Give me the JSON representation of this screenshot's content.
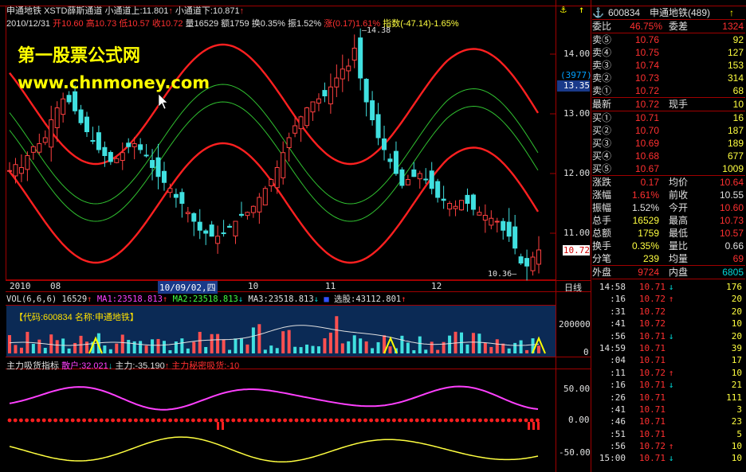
{
  "header": {
    "name": "申通地铁",
    "indicator": "XSTD薛斯通道",
    "upper_label": "小通道上:11.801",
    "lower_label": "小通道下:10.871",
    "date": "2010/12/31",
    "open": "开10.60",
    "high": "高10.73",
    "low": "低10.57",
    "close": "收10.72",
    "volume": "量16529",
    "amount": "额1759",
    "turnover": "换0.35%",
    "amplitude": "振1.52%",
    "change": "涨(0.17)1.61%",
    "index": "指数(-47.14)-1.65%"
  },
  "watermark": {
    "line1": "第一股票公式网",
    "line2": "www.chnmoney.com"
  },
  "price_chart": {
    "max_label": "14.38",
    "min_label": "10.36",
    "axis": [
      "14.00",
      "13.00",
      "12.00",
      "11.00"
    ],
    "cursor_count": "(3977)",
    "cursor_price": "13.35",
    "current_price": "10.72",
    "close_series": [
      12.05,
      12.15,
      12.1,
      12.3,
      12.45,
      12.5,
      12.6,
      12.9,
      13.1,
      13.25,
      13.2,
      13.05,
      12.85,
      12.7,
      12.55,
      12.4,
      12.3,
      12.2,
      12.25,
      12.35,
      12.45,
      12.5,
      12.4,
      12.3,
      12.1,
      11.95,
      11.85,
      11.75,
      11.6,
      11.5,
      11.35,
      11.2,
      11.05,
      11.0,
      10.95,
      10.95,
      11.0,
      11.1,
      11.2,
      11.3,
      11.35,
      11.45,
      11.6,
      11.75,
      11.9,
      12.1,
      12.35,
      12.6,
      12.8,
      12.95,
      13.1,
      13.2,
      13.25,
      13.3,
      13.45,
      13.6,
      13.75,
      13.8,
      14.1,
      13.6,
      13.2,
      12.9,
      12.6,
      12.4,
      12.2,
      12.0,
      11.8,
      11.9,
      11.95,
      12.0,
      11.9,
      11.75,
      11.6,
      11.55,
      11.5,
      11.45,
      11.55,
      11.5,
      11.4,
      11.35,
      11.3,
      11.25,
      11.2,
      11.05,
      10.95,
      10.75,
      10.5,
      10.45,
      10.6,
      10.72
    ]
  },
  "axis_dates": [
    "2010",
    "08",
    "10/09/02,四",
    "10",
    "11",
    "12"
  ],
  "period_label": "日线",
  "volume_panel": {
    "title": "VOL(6,6,6)",
    "vol": "16529",
    "ma1": "MA1:23518.813",
    "ma2": "MA2:23518.813",
    "ma3": "MA3:23518.813",
    "extra": "选股:43112.801",
    "code_text": "【代码:600834  名称:申通地铁】",
    "axis": [
      "200000",
      "100000",
      "0"
    ]
  },
  "indicator_panel": {
    "title": "主力吸货指标",
    "retail": "散户:32.021",
    "main": "主力:-35.190",
    "secret": "主力秘密吸货:-10",
    "axis": [
      "50.00",
      "0.00",
      "-50.00"
    ]
  },
  "quote": {
    "code": "600834",
    "name": "申通地铁(489)",
    "wei_bi_label": "委比",
    "wei_bi": "46.75%",
    "wei_cha_label": "委差",
    "wei_cha": "1324",
    "asks": [
      {
        "label": "卖⑤",
        "price": "10.76",
        "vol": "92"
      },
      {
        "label": "卖④",
        "price": "10.75",
        "vol": "127"
      },
      {
        "label": "卖③",
        "price": "10.74",
        "vol": "153"
      },
      {
        "label": "卖②",
        "price": "10.73",
        "vol": "314"
      },
      {
        "label": "卖①",
        "price": "10.72",
        "vol": "68"
      }
    ],
    "latest_label": "最新",
    "latest": "10.72",
    "now_label": "现手",
    "now_vol": "10",
    "bids": [
      {
        "label": "买①",
        "price": "10.71",
        "vol": "16"
      },
      {
        "label": "买②",
        "price": "10.70",
        "vol": "187"
      },
      {
        "label": "买③",
        "price": "10.69",
        "vol": "189"
      },
      {
        "label": "买④",
        "price": "10.68",
        "vol": "677"
      },
      {
        "label": "买⑤",
        "price": "10.67",
        "vol": "1009"
      }
    ],
    "stats": [
      {
        "l1": "涨跌",
        "v1": "0.17",
        "l2": "均价",
        "v2": "10.64"
      },
      {
        "l1": "涨幅",
        "v1": "1.61%",
        "l2": "前收",
        "v2": "10.55"
      },
      {
        "l1": "振幅",
        "v1": "1.52%",
        "l2": "今开",
        "v2": "10.60"
      },
      {
        "l1": "总手",
        "v1": "16529",
        "l2": "最高",
        "v2": "10.73"
      },
      {
        "l1": "总额",
        "v1": "1759",
        "l2": "最低",
        "v2": "10.57"
      },
      {
        "l1": "换手",
        "v1": "0.35%",
        "l2": "量比",
        "v2": "0.66"
      },
      {
        "l1": "分笔",
        "v1": "239",
        "l2": "均量",
        "v2": "69"
      }
    ],
    "outer_label": "外盘",
    "outer": "9724",
    "inner_label": "内盘",
    "inner": "6805"
  },
  "ticks": [
    {
      "time": "14:58",
      "price": "10.71",
      "dir": "↓",
      "vol": "176"
    },
    {
      "time": ":16",
      "price": "10.72",
      "dir": "↑",
      "vol": "20"
    },
    {
      "time": ":31",
      "price": "10.72",
      "dir": "",
      "vol": "20"
    },
    {
      "time": ":41",
      "price": "10.72",
      "dir": "",
      "vol": "10"
    },
    {
      "time": ":56",
      "price": "10.71",
      "dir": "↓",
      "vol": "20"
    },
    {
      "time": "14:59",
      "price": "10.71",
      "dir": "",
      "vol": "39"
    },
    {
      "time": ":04",
      "price": "10.71",
      "dir": "",
      "vol": "17"
    },
    {
      "time": ":11",
      "price": "10.72",
      "dir": "↑",
      "vol": "10"
    },
    {
      "time": ":16",
      "price": "10.71",
      "dir": "↓",
      "vol": "21"
    },
    {
      "time": ":26",
      "price": "10.71",
      "dir": "",
      "vol": "111"
    },
    {
      "time": ":41",
      "price": "10.71",
      "dir": "",
      "vol": "3"
    },
    {
      "time": ":46",
      "price": "10.71",
      "dir": "",
      "vol": "23"
    },
    {
      "time": ":51",
      "price": "10.71",
      "dir": "",
      "vol": "5"
    },
    {
      "time": ":56",
      "price": "10.72",
      "dir": "↑",
      "vol": "10"
    },
    {
      "time": "15:00",
      "price": "10.71",
      "dir": "↓",
      "vol": "10"
    }
  ]
}
